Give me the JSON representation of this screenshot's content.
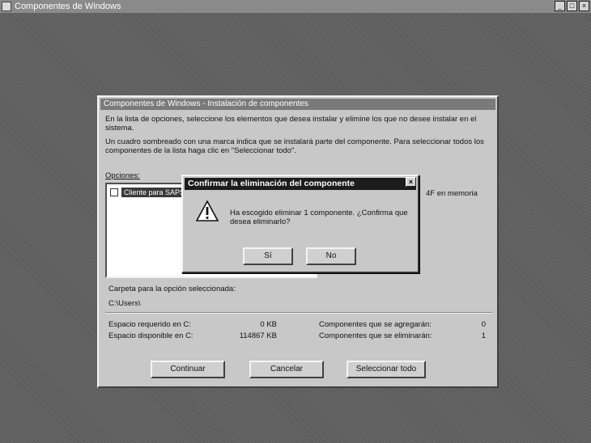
{
  "app": {
    "title": "Componentes de Windows",
    "controls": [
      "_",
      "□",
      "×"
    ]
  },
  "dialog": {
    "title": "Componentes de Windows - Instalación de componentes",
    "description_1": "En la lista de opciones, seleccione los elementos que desea instalar y elimine los que no desee instalar en el sistema.",
    "description_2": "Un cuadro sombreado con una marca indica que se instalará parte del componente. Para seleccionar todos los componentes de la lista haga clic en \"Seleccionar todo\".",
    "options_label": "Opciones:",
    "options": [
      {
        "label": "Cliente para SAPS",
        "checked": false,
        "selected": true
      }
    ],
    "side_note": "4F en memoria",
    "folder_label": "Carpeta para la opción seleccionada:",
    "folder_value": "C:\\Users\\",
    "space_required_label": "Espacio requerido en C:",
    "space_required_value": "0 KB",
    "space_available_label": "Espacio disponible en C:",
    "space_available_value": "114867 KB",
    "components_added_label": "Componentes que se agregarán:",
    "components_added_value": "0",
    "components_removed_label": "Componentes que se eliminarán:",
    "components_removed_value": "1",
    "buttons": {
      "continue": "Continuar",
      "cancel": "Cancelar",
      "select_all": "Seleccionar todo"
    }
  },
  "confirm": {
    "title": "Confirmar la eliminación del componente",
    "close": "×",
    "icon": "warning-icon",
    "message": "Ha escogido eliminar 1 componente. ¿Confirma que desea eliminarlo?",
    "buttons": {
      "yes": "Sí",
      "no": "No"
    }
  }
}
